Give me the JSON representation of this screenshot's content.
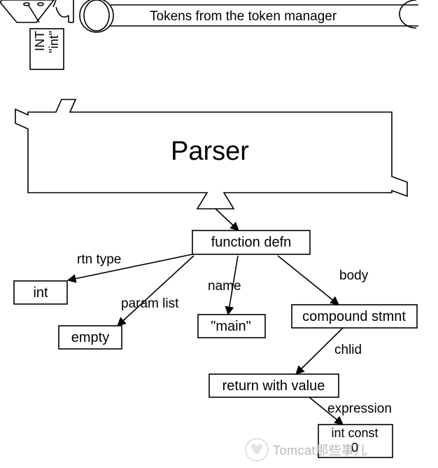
{
  "header_caption": "Tokens from the token manager",
  "token_chip": {
    "line1": "INT",
    "line2": "\"int\""
  },
  "parser_label": "Parser",
  "tree": {
    "root": "function defn",
    "edges": {
      "rtn_type": "rtn type",
      "param_list": "param list",
      "name": "name",
      "body": "body",
      "child": "chlid",
      "expression": "expression"
    },
    "nodes": {
      "int": "int",
      "empty": "empty",
      "main": "\"main\"",
      "compound": "compound stmnt",
      "return": "return with value",
      "int_const_line1": "int const",
      "int_const_line2": "0"
    }
  },
  "watermark": "Tomcat那些事儿"
}
